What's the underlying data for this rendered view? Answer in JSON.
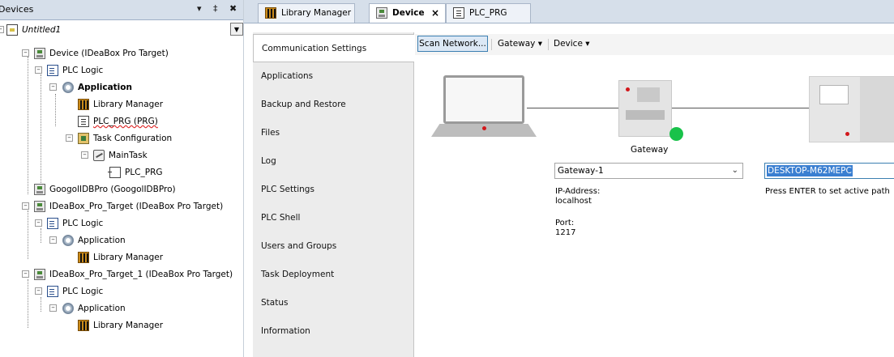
{
  "devices_panel": {
    "title": "Devices",
    "pin": "↓ ɨ",
    "close": "✖",
    "root": "Untitled1"
  },
  "tree": [
    {
      "label": "Device (IDeaBox Pro Target)",
      "icon": "device-icon"
    },
    {
      "label": "PLC Logic",
      "icon": "plc-logic-icon"
    },
    {
      "label": "Application",
      "icon": "application-gear-icon",
      "bold": true
    },
    {
      "label": "Library Manager",
      "icon": "library-manager-icon"
    },
    {
      "label": "PLC_PRG (PRG)",
      "icon": "program-icon"
    },
    {
      "label": "Task Configuration",
      "icon": "task-configuration-icon"
    },
    {
      "label": "MainTask",
      "icon": "main-task-icon"
    },
    {
      "label": "PLC_PRG",
      "icon": "program-call-icon"
    },
    {
      "label": "GoogolIDBPro (GoogolIDBPro)",
      "icon": "device-icon"
    },
    {
      "label": "IDeaBox_Pro_Target (IDeaBox Pro Target)",
      "icon": "device-icon"
    },
    {
      "label": "PLC Logic",
      "icon": "plc-logic-icon"
    },
    {
      "label": "Application",
      "icon": "application-gear-icon"
    },
    {
      "label": "Library Manager",
      "icon": "library-manager-icon"
    },
    {
      "label": "IDeaBox_Pro_Target_1 (IDeaBox Pro Target)",
      "icon": "device-icon"
    },
    {
      "label": "PLC Logic",
      "icon": "plc-logic-icon"
    },
    {
      "label": "Application",
      "icon": "application-gear-icon"
    },
    {
      "label": "Library Manager",
      "icon": "library-manager-icon"
    }
  ],
  "tabs": [
    {
      "label": "Library Manager",
      "icon": "library-manager-icon",
      "active": false
    },
    {
      "label": "Device",
      "icon": "device-icon",
      "active": true,
      "close": "×"
    },
    {
      "label": "PLC_PRG",
      "icon": "program-icon",
      "active": false
    }
  ],
  "nav": [
    {
      "label": "Communication Settings",
      "active": true
    },
    {
      "label": "Applications"
    },
    {
      "label": "Backup and Restore"
    },
    {
      "label": "Files"
    },
    {
      "label": "Log"
    },
    {
      "label": "PLC Settings"
    },
    {
      "label": "PLC Shell"
    },
    {
      "label": "Users and Groups"
    },
    {
      "label": "Task Deployment"
    },
    {
      "label": "Status"
    },
    {
      "label": "Information"
    }
  ],
  "toolbar": {
    "scan": "Scan Network...",
    "gateway": "Gateway ▾",
    "device": "Device ▾"
  },
  "topology": {
    "gateway_label": "Gateway",
    "gateway_select": "Gateway-1",
    "ip_label": "IP-Address:",
    "ip_value": "localhost",
    "port_label": "Port:",
    "port_value": "1217",
    "device_input": "DESKTOP-M62MEPC",
    "device_hint": "Press ENTER to set active path"
  },
  "colors": {
    "status_green": "#19c24a",
    "selection_blue": "#3a7fd1"
  }
}
